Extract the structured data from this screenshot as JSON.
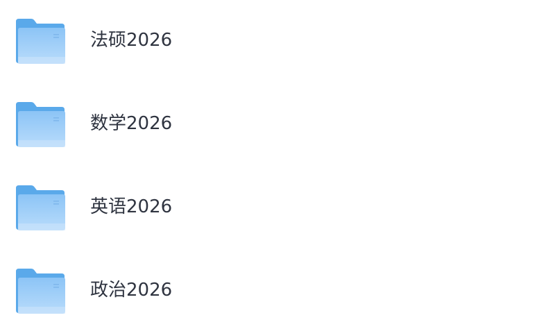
{
  "folders": [
    {
      "name": "法硕2026",
      "icon": "folder-icon"
    },
    {
      "name": "数学2026",
      "icon": "folder-icon"
    },
    {
      "name": "英语2026",
      "icon": "folder-icon"
    },
    {
      "name": "政治2026",
      "icon": "folder-icon"
    }
  ],
  "colors": {
    "folder_back": "#5aa9ea",
    "folder_front_top": "#8cc4f6",
    "folder_front_bottom": "#b9dcfb",
    "text": "#2f3440"
  }
}
